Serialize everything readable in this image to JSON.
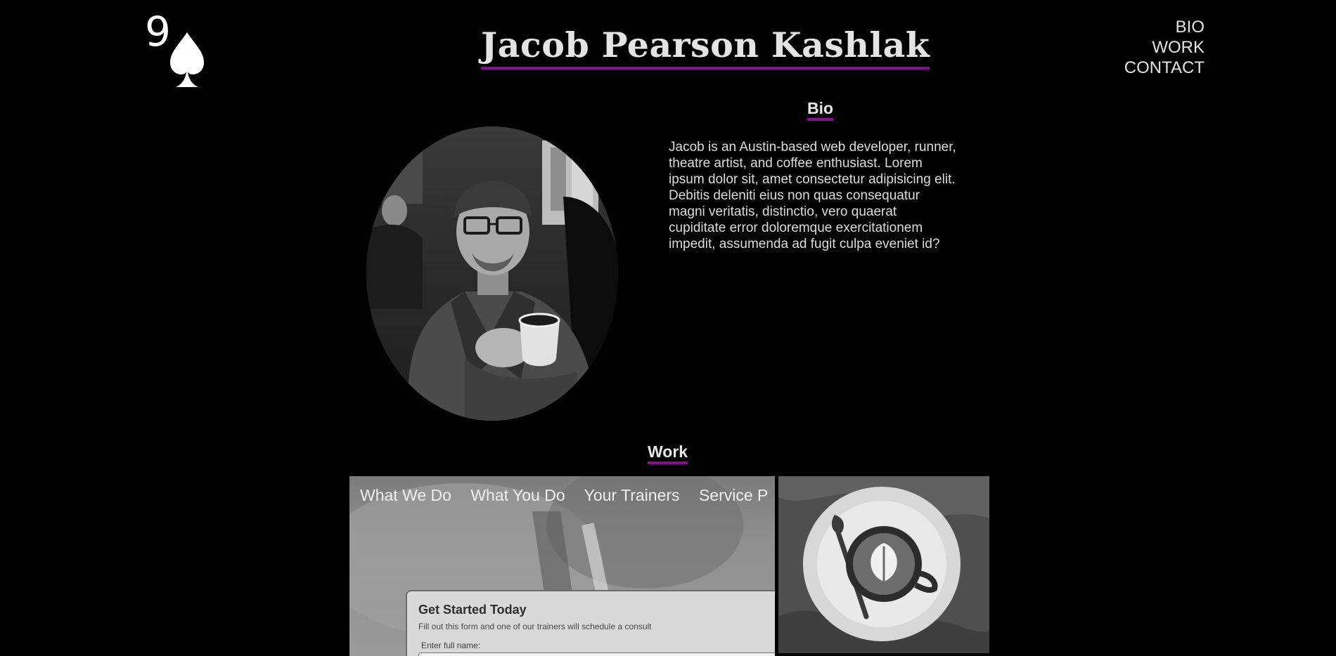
{
  "logo": {
    "number": "9",
    "suit": "spade"
  },
  "header": {
    "title": "Jacob Pearson Kashlak"
  },
  "nav": {
    "items": [
      "BIO",
      "WORK",
      "CONTACT"
    ]
  },
  "bio": {
    "heading": "Bio",
    "text": "Jacob is an Austin-based web developer, runner, theatre artist, and coffee enthusiast. Lorem ipsum dolor sit, amet consectetur adipisicing elit. Debitis deleniti eius non quas consequatur magni veritatis, distinctio, vero quaerat cupiditate error doloremque exercitationem impedit, assumenda ad fugit culpa eveniet id?"
  },
  "work": {
    "heading": "Work",
    "project1": {
      "nav": [
        "What We Do",
        "What You Do",
        "Your Trainers",
        "Service P"
      ],
      "form_title": "Get Started Today",
      "form_subtitle": "Fill out this form and one of our trainers will schedule a consult",
      "form_label": "Enter full name:"
    }
  },
  "colors": {
    "background": "#000000",
    "accent": "#8a0e8f",
    "text": "#d6d6d6"
  }
}
